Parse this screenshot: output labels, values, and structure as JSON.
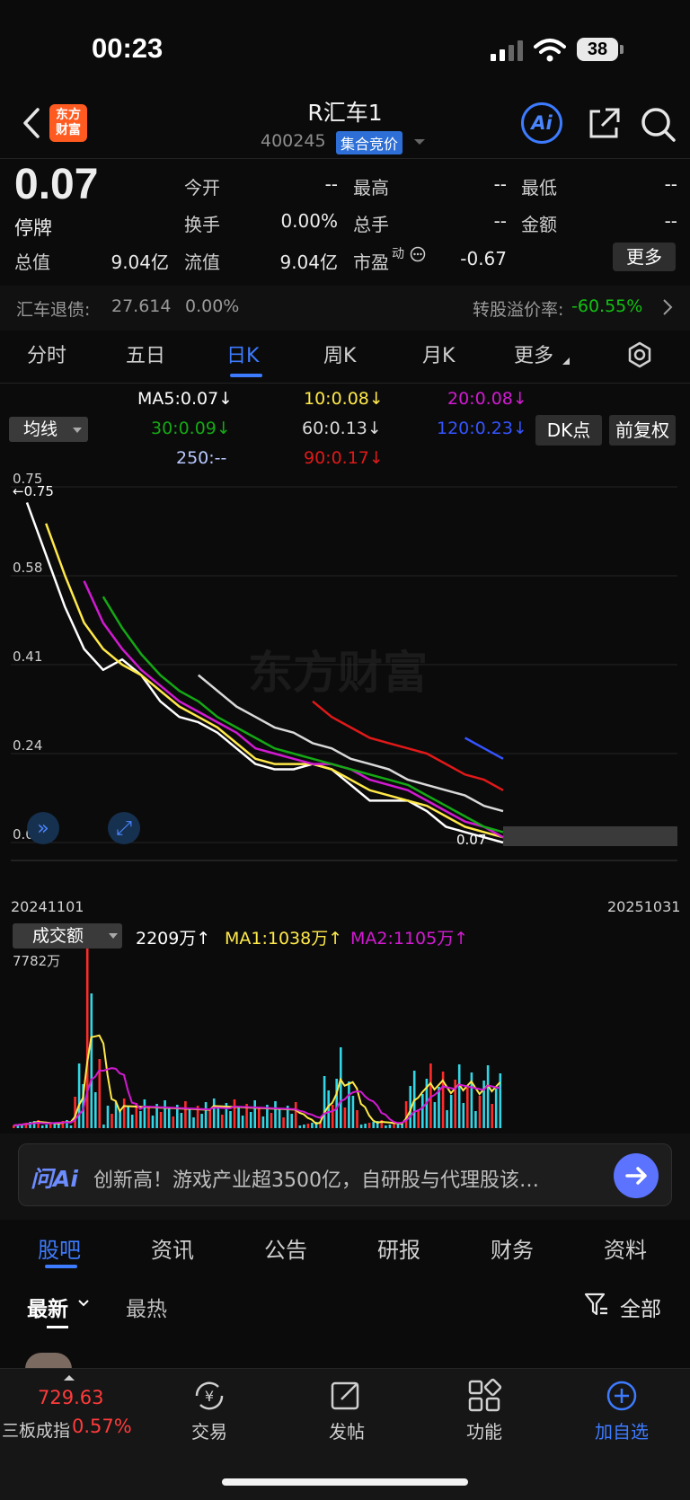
{
  "status_bar": {
    "time": "00:23",
    "battery": "38"
  },
  "header": {
    "brand_line1": "东方",
    "brand_line2": "财富",
    "title": "R汇车1",
    "code": "400245",
    "auction_tag": "集合竞价",
    "ai_label": "Ai"
  },
  "quote": {
    "price": "0.07",
    "status": "停牌",
    "fields": [
      {
        "label": "今开",
        "value": "--"
      },
      {
        "label": "最高",
        "value": "--"
      },
      {
        "label": "最低",
        "value": "--"
      },
      {
        "label": "换手",
        "value": "0.00%"
      },
      {
        "label": "总手",
        "value": "--"
      },
      {
        "label": "金额",
        "value": "--"
      },
      {
        "label": "总值",
        "value": "9.04亿"
      },
      {
        "label": "流值",
        "value": "9.04亿"
      },
      {
        "label": "市盈",
        "value": "-0.67"
      }
    ],
    "pe_suffix": "动",
    "more_label": "更多"
  },
  "bond": {
    "name": "汇车退债:",
    "price": "27.614",
    "change": "0.00%",
    "premium_label": "转股溢价率:",
    "premium_value": "-60.55%"
  },
  "chart_tabs": [
    "分时",
    "五日",
    "日K",
    "周K",
    "月K",
    "更多"
  ],
  "active_chart_tab": "日K",
  "ma_legend": {
    "selector": "均线",
    "items": [
      {
        "text": "MA5:0.07↓",
        "color": "#ffffff"
      },
      {
        "text": "10:0.08↓",
        "color": "#ffe94a"
      },
      {
        "text": "20:0.08↓",
        "color": "#d21ad2"
      },
      {
        "text": "30:0.09↓",
        "color": "#15a815"
      },
      {
        "text": "60:0.13↓",
        "color": "#d9d9d9"
      },
      {
        "text": "120:0.23↓",
        "color": "#3554ff"
      },
      {
        "text": "250:--",
        "color": "#b9c8ff"
      },
      {
        "text": "90:0.17↓",
        "color": "#e01919"
      }
    ],
    "dk_label": "DK点",
    "adjust_label": "前复权"
  },
  "chart_data": {
    "type": "line",
    "title": "",
    "x_range": [
      "20241101",
      "20251031"
    ],
    "y_ticks": [
      0.75,
      0.58,
      0.41,
      0.24,
      0.07
    ],
    "ylim": [
      0.07,
      0.75
    ],
    "annotations": [
      "←0.75",
      "0.07"
    ],
    "watermark": "东方财富",
    "grid": true,
    "series": [
      {
        "name": "MA5",
        "color": "#ffffff",
        "values": [
          0.72,
          0.62,
          0.52,
          0.44,
          0.4,
          0.42,
          0.39,
          0.34,
          0.31,
          0.3,
          0.28,
          0.25,
          0.22,
          0.21,
          0.21,
          0.22,
          0.21,
          0.18,
          0.15,
          0.15,
          0.15,
          0.13,
          0.1,
          0.09,
          0.08,
          0.07
        ]
      },
      {
        "name": "10",
        "color": "#ffe94a",
        "values": [
          null,
          0.68,
          0.58,
          0.49,
          0.44,
          0.41,
          0.39,
          0.36,
          0.33,
          0.31,
          0.29,
          0.26,
          0.23,
          0.22,
          0.22,
          0.22,
          0.21,
          0.19,
          0.17,
          0.16,
          0.15,
          0.14,
          0.12,
          0.1,
          0.09,
          0.08
        ]
      },
      {
        "name": "20",
        "color": "#d21ad2",
        "values": [
          null,
          null,
          null,
          0.57,
          0.49,
          0.44,
          0.4,
          0.37,
          0.34,
          0.32,
          0.3,
          0.28,
          0.25,
          0.24,
          0.23,
          0.22,
          0.22,
          0.21,
          0.19,
          0.18,
          0.17,
          0.15,
          0.13,
          0.11,
          0.1,
          0.08
        ]
      },
      {
        "name": "30",
        "color": "#15a815",
        "values": [
          null,
          null,
          null,
          null,
          0.54,
          0.48,
          0.43,
          0.39,
          0.36,
          0.34,
          0.31,
          0.29,
          0.27,
          0.25,
          0.24,
          0.23,
          0.22,
          0.21,
          0.2,
          0.19,
          0.18,
          0.16,
          0.14,
          0.12,
          0.1,
          0.09
        ]
      },
      {
        "name": "60",
        "color": "#d9d9d9",
        "values": [
          null,
          null,
          null,
          null,
          null,
          null,
          null,
          null,
          null,
          0.39,
          0.36,
          0.33,
          0.31,
          0.29,
          0.28,
          0.26,
          0.25,
          0.23,
          0.22,
          0.21,
          0.19,
          0.18,
          0.17,
          0.16,
          0.14,
          0.13
        ]
      },
      {
        "name": "90",
        "color": "#e01919",
        "values": [
          null,
          null,
          null,
          null,
          null,
          null,
          null,
          null,
          null,
          null,
          null,
          null,
          null,
          null,
          null,
          0.34,
          0.31,
          0.29,
          0.27,
          0.26,
          0.25,
          0.24,
          0.22,
          0.2,
          0.19,
          0.17
        ]
      },
      {
        "name": "120",
        "color": "#3554ff",
        "values": [
          null,
          null,
          null,
          null,
          null,
          null,
          null,
          null,
          null,
          null,
          null,
          null,
          null,
          null,
          null,
          null,
          null,
          null,
          null,
          null,
          null,
          null,
          null,
          0.27,
          0.25,
          0.23
        ]
      }
    ]
  },
  "volume": {
    "selector": "成交额",
    "current": "2209万↑",
    "ma1": "MA1:1038万↑",
    "ma2": "MA2:1105万↑",
    "max_label": "7782万"
  },
  "ai_bar": {
    "logo": "问Ai",
    "text": "创新高！游戏产业超3500亿，自研股与代理股该…"
  },
  "news_tabs": [
    "股吧",
    "资讯",
    "公告",
    "研报",
    "财务",
    "资料"
  ],
  "sort_tabs": [
    "最新",
    "最热"
  ],
  "filter_label": "全部",
  "bottom_nav": {
    "index_value": "729.63",
    "index_name": "三板成指",
    "index_change": "0.57%",
    "items": [
      "交易",
      "发帖",
      "功能",
      "加自选"
    ]
  }
}
